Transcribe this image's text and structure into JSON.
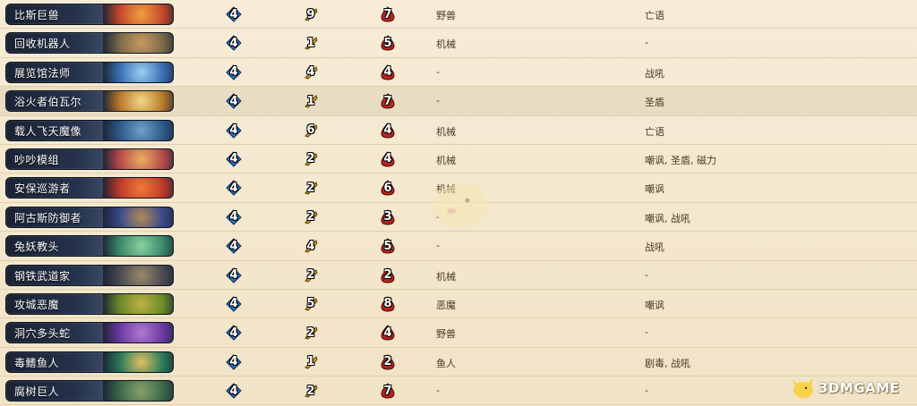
{
  "rows": [
    {
      "name": "比斯巨兽",
      "cost": "4",
      "attack": "9",
      "health": "7",
      "race": "野兽",
      "keywords": "亡语",
      "art": "#c6472a",
      "art2": "#f0a040"
    },
    {
      "name": "回收机器人",
      "cost": "4",
      "attack": "1",
      "health": "5",
      "race": "机械",
      "keywords": "-",
      "art": "#7b6a4a",
      "art2": "#c99a5e"
    },
    {
      "name": "展览馆法师",
      "cost": "4",
      "attack": "4",
      "health": "4",
      "race": "-",
      "keywords": "战吼",
      "art": "#3a6fb3",
      "art2": "#9ad0f0"
    },
    {
      "name": "浴火者伯瓦尔",
      "cost": "4",
      "attack": "1",
      "health": "7",
      "race": "-",
      "keywords": "圣盾",
      "art": "#b87a2a",
      "art2": "#f2d88a"
    },
    {
      "name": "载人飞天魔像",
      "cost": "4",
      "attack": "6",
      "health": "4",
      "race": "机械",
      "keywords": "亡语",
      "art": "#2f5a8a",
      "art2": "#6fa0c8"
    },
    {
      "name": "吵吵模组",
      "cost": "4",
      "attack": "2",
      "health": "4",
      "race": "机械",
      "keywords": "嘲讽, 圣盾, 磁力",
      "art": "#b84a4a",
      "art2": "#e8b060"
    },
    {
      "name": "安保巡游者",
      "cost": "4",
      "attack": "2",
      "health": "6",
      "race": "机械",
      "keywords": "嘲讽",
      "art": "#c03a2a",
      "art2": "#f07a3a"
    },
    {
      "name": "阿古斯防御者",
      "cost": "4",
      "attack": "2",
      "health": "3",
      "race": "-",
      "keywords": "嘲讽, 战吼",
      "art": "#3a4a8a",
      "art2": "#b08a5a"
    },
    {
      "name": "兔妖教头",
      "cost": "4",
      "attack": "4",
      "health": "5",
      "race": "-",
      "keywords": "战吼",
      "art": "#3a8a6a",
      "art2": "#8ad0a0"
    },
    {
      "name": "钢铁武道家",
      "cost": "4",
      "attack": "2",
      "health": "2",
      "race": "机械",
      "keywords": "-",
      "art": "#4a4a52",
      "art2": "#9a8a6a"
    },
    {
      "name": "攻城恶魔",
      "cost": "4",
      "attack": "5",
      "health": "8",
      "race": "恶魔",
      "keywords": "嘲讽",
      "art": "#6a8a2a",
      "art2": "#c0b040"
    },
    {
      "name": "洞穴多头蛇",
      "cost": "4",
      "attack": "2",
      "health": "4",
      "race": "野兽",
      "keywords": "-",
      "art": "#6a3aa0",
      "art2": "#b07ad0"
    },
    {
      "name": "毒鳍鱼人",
      "cost": "4",
      "attack": "1",
      "health": "2",
      "race": "鱼人",
      "keywords": "剧毒, 战吼",
      "art": "#2a7a5a",
      "art2": "#e0c060"
    },
    {
      "name": "腐树巨人",
      "cost": "4",
      "attack": "2",
      "health": "7",
      "race": "-",
      "keywords": "-",
      "art": "#3a6a4a",
      "art2": "#8aa06a"
    }
  ],
  "logo": {
    "text": "3DMGAME"
  },
  "colors": {
    "cost": "#2a6fc9",
    "attack": "#d9a21c",
    "health": "#b3261e",
    "background": "#f3e8d0"
  },
  "icons": {
    "cost": "mana-crystal-icon",
    "attack": "attack-sword-icon",
    "health": "health-drop-icon"
  }
}
